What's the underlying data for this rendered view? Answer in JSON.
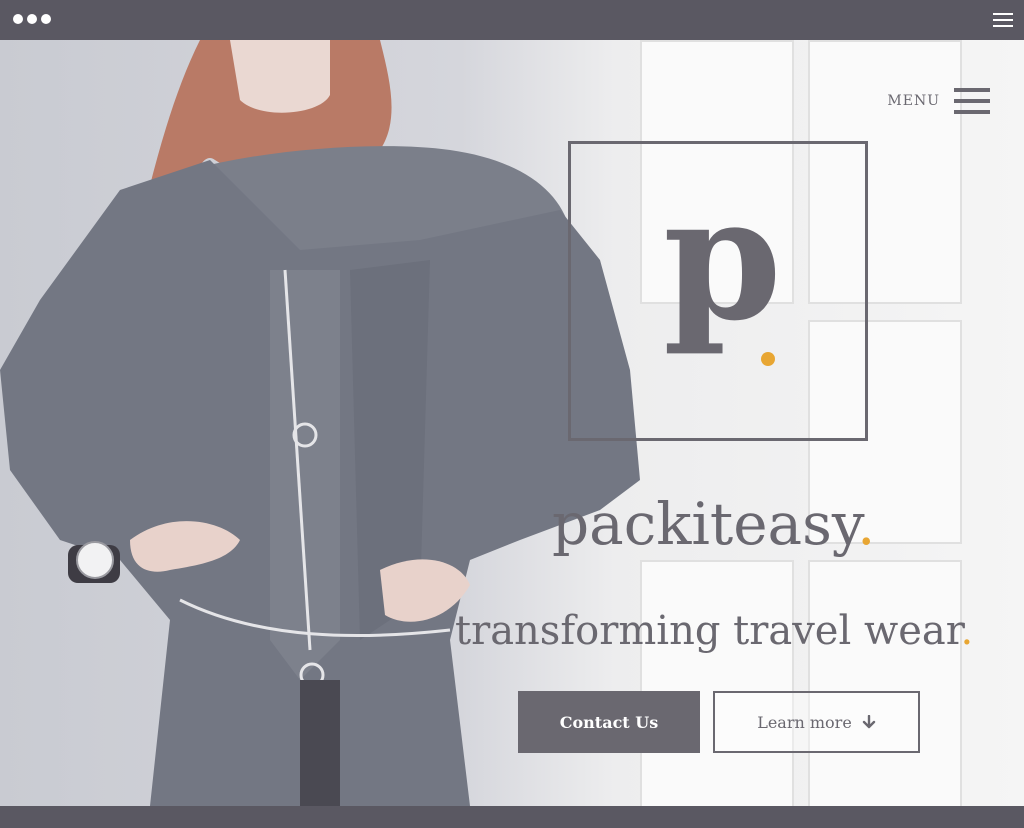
{
  "hero": {
    "menu_label": "MENU",
    "logo_letter": "p",
    "brand_name": "packiteasy",
    "tagline": "transforming travel wear",
    "accent_dot": "."
  },
  "buttons": {
    "contact": "Contact Us",
    "learn": "Learn more"
  },
  "colors": {
    "frame": "#5a5862",
    "text": "#6a6870",
    "accent": "#e8a633"
  },
  "icons": {
    "window": "window-dots-icon",
    "topbar_menu": "hamburger-icon",
    "menu": "hamburger-icon",
    "learn": "arrow-down-icon"
  }
}
